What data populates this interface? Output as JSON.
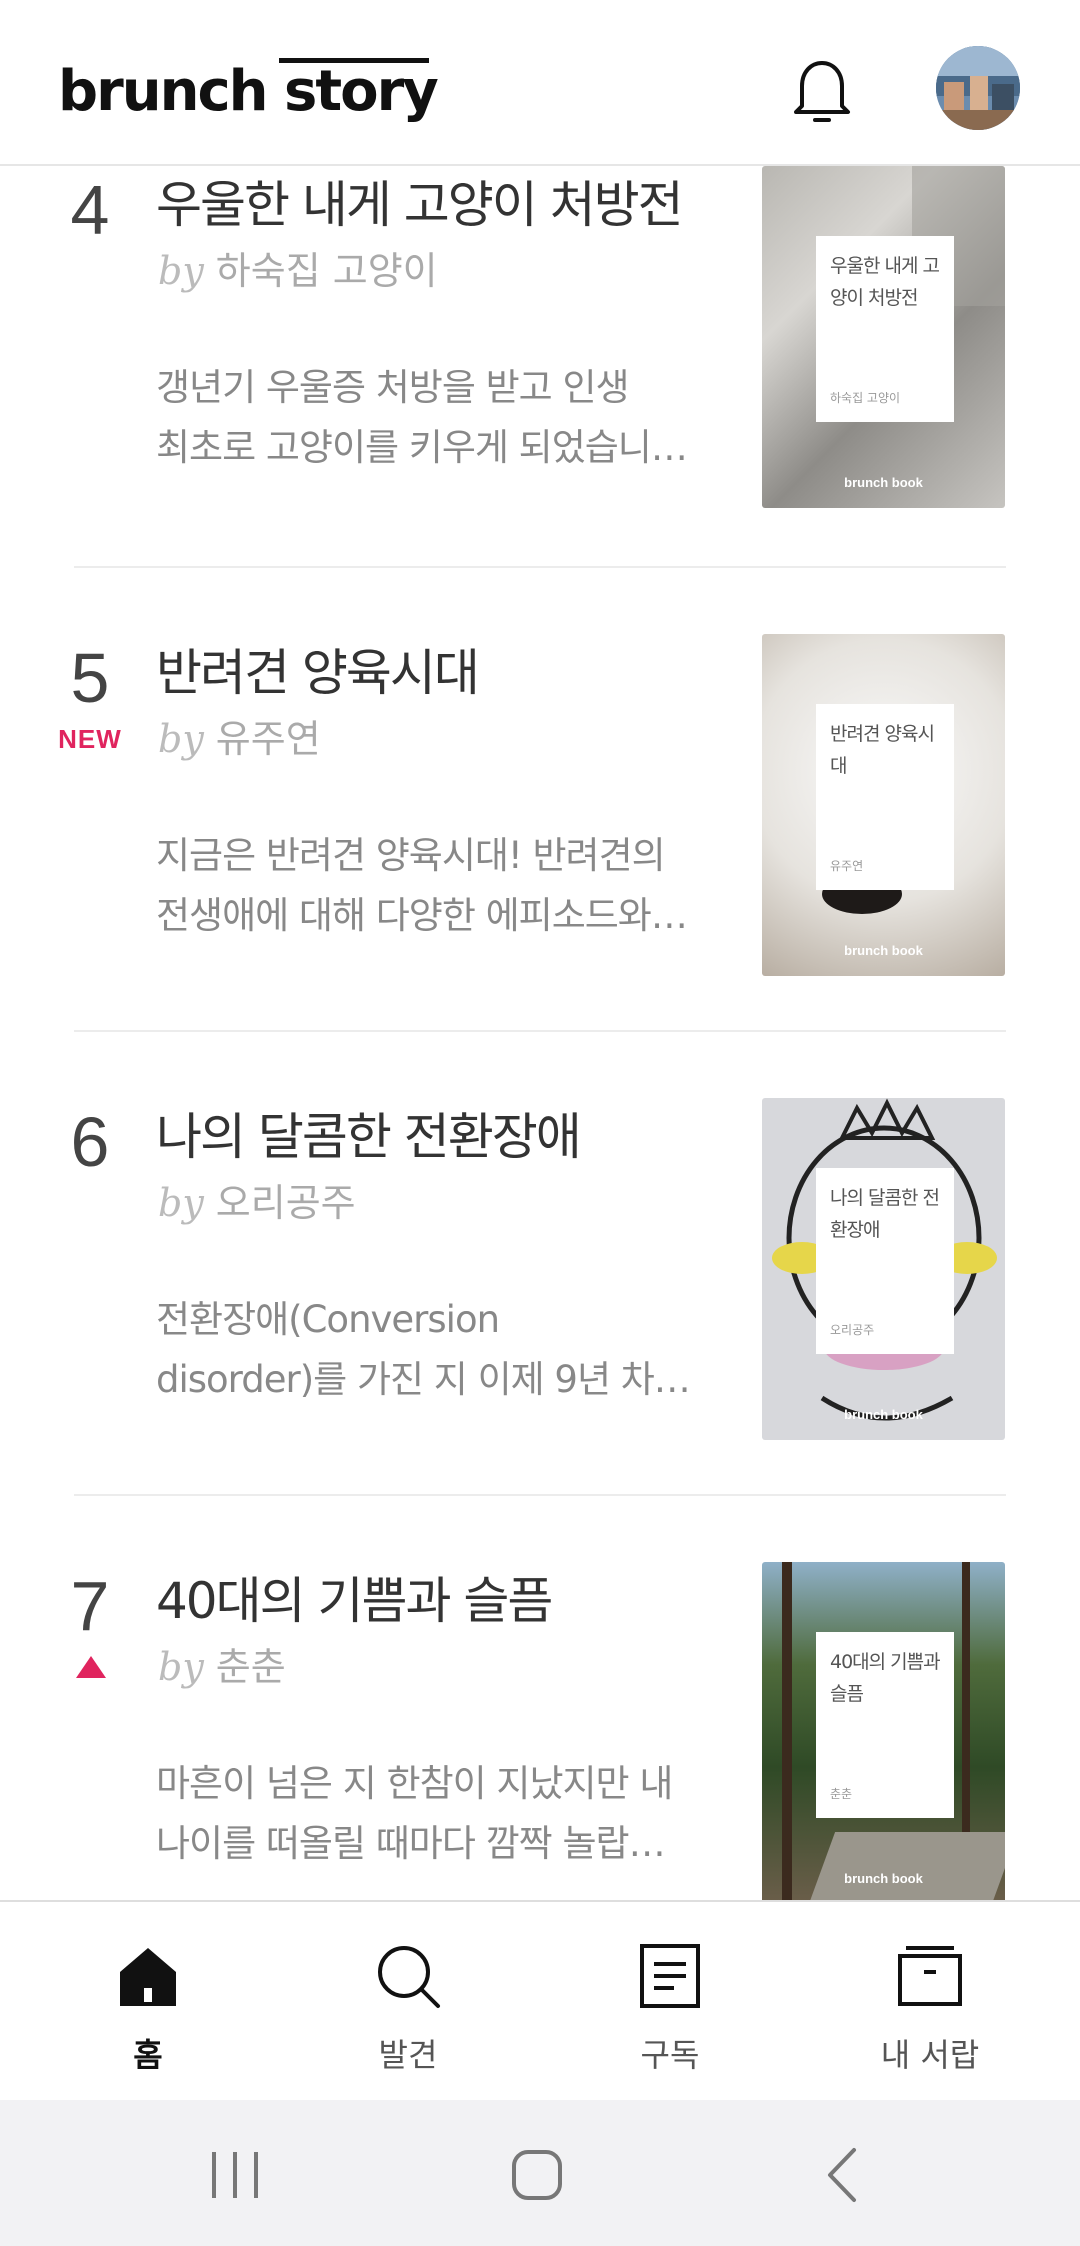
{
  "header": {
    "logo_text": "brunch story",
    "bell_icon": "bell-icon",
    "avatar_icon": "profile-avatar"
  },
  "items": [
    {
      "rank": "4",
      "badge": "",
      "title": "우울한 내게 고양이 처방전",
      "by": "by",
      "author": "하숙집 고양이",
      "desc_line1": "갱년기 우울증 처방을 받고 인생",
      "desc_line2": "최초로 고양이를 키우게 되었습니…",
      "cover_title": "우울한 내게 고양이 처방전",
      "cover_author": "하숙집 고양이",
      "cover_brand": "brunch book"
    },
    {
      "rank": "5",
      "badge": "NEW",
      "title": "반려견 양육시대",
      "by": "by",
      "author": "유주연",
      "desc_line1": "지금은 반려견 양육시대! 반려견의",
      "desc_line2": "전생애에 대해 다양한 에피소드와…",
      "cover_title": "반려견 양육시대",
      "cover_author": "유주연",
      "cover_brand": "brunch book"
    },
    {
      "rank": "6",
      "badge": "",
      "title": "나의 달콤한 전환장애",
      "by": "by",
      "author": "오리공주",
      "desc_line1": "전환장애(Conversion",
      "desc_line2": "disorder)를 가진 지 이제 9년 차…",
      "cover_title": "나의 달콤한 전환장애",
      "cover_author": "오리공주",
      "cover_brand": "brunch book"
    },
    {
      "rank": "7",
      "badge": "up",
      "title": "40대의 기쁨과 슬픔",
      "by": "by",
      "author": "춘춘",
      "desc_line1": "마흔이 넘은 지 한참이 지났지만 내",
      "desc_line2": "나이를 떠올릴 때마다 깜짝 놀랍…",
      "cover_title": "40대의 기쁨과 슬픔",
      "cover_author": "춘춘",
      "cover_brand": "brunch book"
    }
  ],
  "bottom_nav": {
    "items": [
      {
        "label": "홈",
        "icon": "home-icon",
        "active": true
      },
      {
        "label": "발견",
        "icon": "search-icon",
        "active": false
      },
      {
        "label": "구독",
        "icon": "document-icon",
        "active": false
      },
      {
        "label": "내 서랍",
        "icon": "drawer-icon",
        "active": false
      }
    ]
  },
  "system_nav": {
    "recents_icon": "recents-icon",
    "home_icon": "home-button-icon",
    "back_icon": "back-icon"
  },
  "colors": {
    "accent": "#e0245e",
    "text_primary": "#333333",
    "text_secondary": "#888888"
  }
}
